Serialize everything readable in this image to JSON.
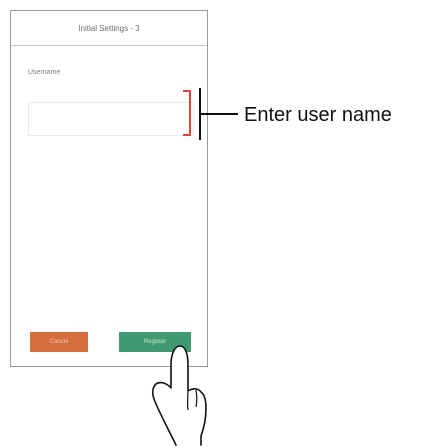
{
  "screen": {
    "title": "Initial Settings - 3",
    "username_label": "Username",
    "username_value": "",
    "cancel_label": "Cancel",
    "register_label": "Register"
  },
  "callout": {
    "text": "Enter user name",
    "bracket_color": "#e0453a"
  },
  "colors": {
    "cancel_button": "#d66d3c",
    "register_button": "#3f9a72"
  },
  "icons": {
    "hand": "pointing-hand-icon"
  }
}
